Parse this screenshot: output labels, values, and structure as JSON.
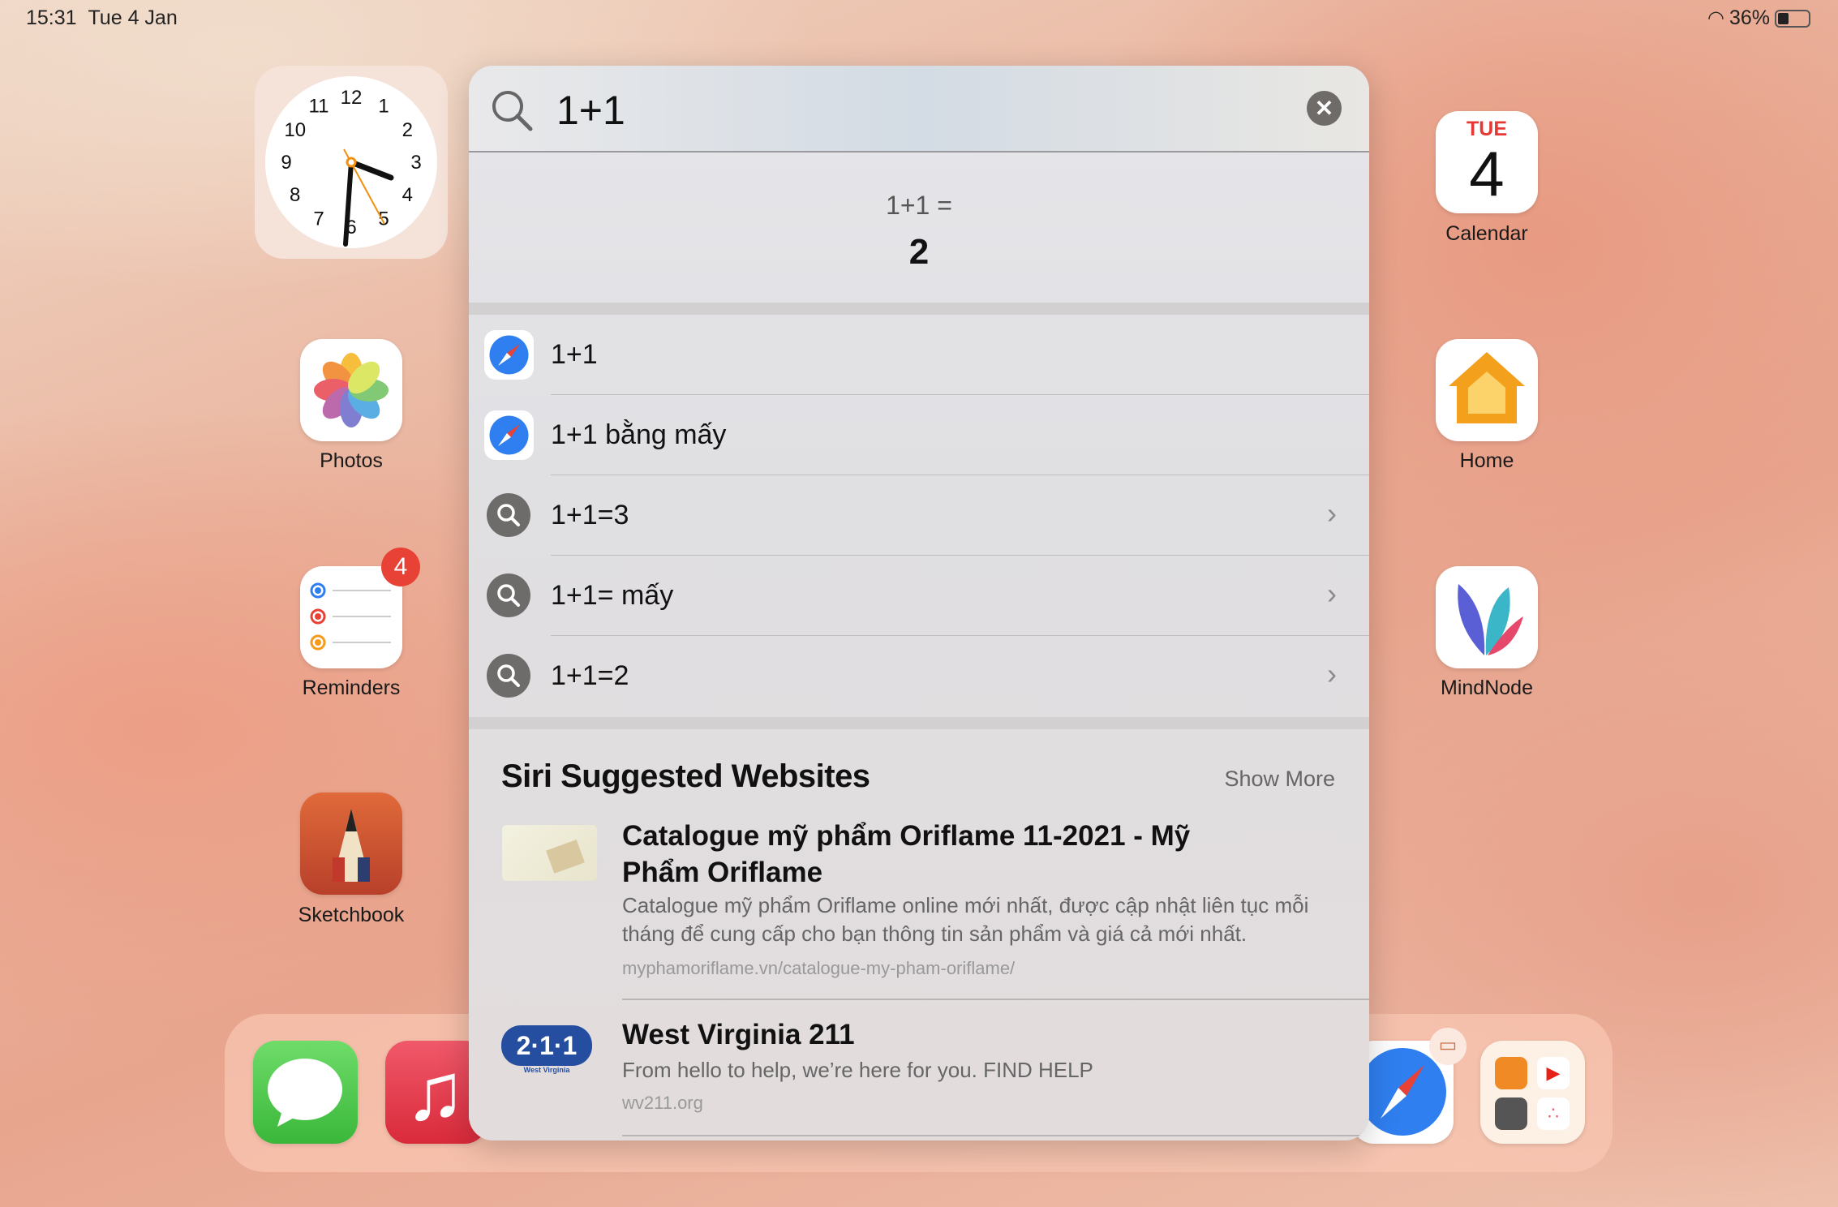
{
  "status_bar": {
    "time": "15:31",
    "date": "Tue 4 Jan",
    "battery": "36%",
    "battery_level": 0.36
  },
  "widgets": {
    "clock": {
      "numbers": [
        "12",
        "1",
        "2",
        "3",
        "4",
        "5",
        "6",
        "7",
        "8",
        "9",
        "10",
        "11"
      ],
      "time": "15:31"
    }
  },
  "home_apps": {
    "left": [
      {
        "label": "Photos"
      },
      {
        "label": "Reminders",
        "badge": "4"
      },
      {
        "label": "Sketchbook"
      }
    ],
    "right": [
      {
        "label": "Calendar",
        "day": "TUE",
        "date": "4"
      },
      {
        "label": "Home"
      },
      {
        "label": "MindNode"
      }
    ]
  },
  "search": {
    "query": "1+1"
  },
  "calculator": {
    "expression": "1+1 =",
    "result": "2"
  },
  "suggestions": [
    {
      "text": "1+1",
      "icon": "safari-icon"
    },
    {
      "text": "1+1 bằng mấy",
      "icon": "safari-icon"
    },
    {
      "text": "1+1=3",
      "icon": "search-icon"
    },
    {
      "text": "1+1= mấy",
      "icon": "search-icon"
    },
    {
      "text": "1+1=2",
      "icon": "search-icon"
    }
  ],
  "siri_websites": {
    "title": "Siri Suggested Websites",
    "show_more": "Show More",
    "items": [
      {
        "title": "Catalogue mỹ phẩm Oriflame 11-2021 - Mỹ Phẩm Oriflame",
        "description": "Catalogue mỹ phẩm Oriflame online mới nhất, được cập nhật liên tục mỗi tháng để cung cấp cho bạn thông tin sản phẩm và giá cả mới nhất.",
        "url": "myphamoriflame.vn/catalogue-my-pham-oriflame/"
      },
      {
        "title": "West Virginia 211",
        "description": "From hello to help, we’re here for you. FIND HELP",
        "url": "wv211.org",
        "logo_text": "2·1·1",
        "logo_sub": "West Virginia"
      }
    ]
  },
  "colors": {
    "accent": "#2f7ff0",
    "badge": "#e84135",
    "calendar_red": "#e53935"
  }
}
